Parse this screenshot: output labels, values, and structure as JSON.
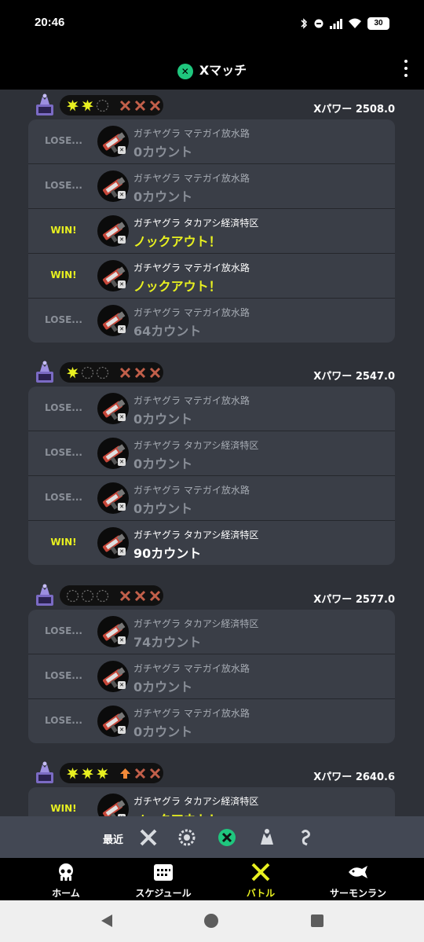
{
  "status": {
    "time": "20:46",
    "battery": "30"
  },
  "appbar": {
    "title": "Xマッチ"
  },
  "groups": [
    {
      "xpower": "Xパワー 2508.0",
      "rows": [
        {
          "result": "LOSE...",
          "type": "lose",
          "mode": "ガチヤグラ マテガイ放水路",
          "score": "0カウント",
          "score_style": "grey"
        },
        {
          "result": "LOSE...",
          "type": "lose",
          "mode": "ガチヤグラ マテガイ放水路",
          "score": "0カウント",
          "score_style": "grey"
        },
        {
          "result": "WIN!",
          "type": "win",
          "mode": "ガチヤグラ タカアシ経済特区",
          "score": "ノックアウト！",
          "score_style": "yellow"
        },
        {
          "result": "WIN!",
          "type": "win",
          "mode": "ガチヤグラ マテガイ放水路",
          "score": "ノックアウト！",
          "score_style": "yellow"
        },
        {
          "result": "LOSE...",
          "type": "lose",
          "mode": "ガチヤグラ マテガイ放水路",
          "score": "64カウント",
          "score_style": "grey"
        }
      ]
    },
    {
      "xpower": "Xパワー 2547.0",
      "rows": [
        {
          "result": "LOSE...",
          "type": "lose",
          "mode": "ガチヤグラ マテガイ放水路",
          "score": "0カウント",
          "score_style": "grey"
        },
        {
          "result": "LOSE...",
          "type": "lose",
          "mode": "ガチヤグラ タカアシ経済特区",
          "score": "0カウント",
          "score_style": "grey"
        },
        {
          "result": "LOSE...",
          "type": "lose",
          "mode": "ガチヤグラ マテガイ放水路",
          "score": "0カウント",
          "score_style": "grey"
        },
        {
          "result": "WIN!",
          "type": "win",
          "mode": "ガチヤグラ タカアシ経済特区",
          "score": "90カウント",
          "score_style": "white"
        }
      ]
    },
    {
      "xpower": "Xパワー 2577.0",
      "rows": [
        {
          "result": "LOSE...",
          "type": "lose",
          "mode": "ガチヤグラ タカアシ経済特区",
          "score": "74カウント",
          "score_style": "grey"
        },
        {
          "result": "LOSE...",
          "type": "lose",
          "mode": "ガチヤグラ マテガイ放水路",
          "score": "0カウント",
          "score_style": "grey"
        },
        {
          "result": "LOSE...",
          "type": "lose",
          "mode": "ガチヤグラ マテガイ放水路",
          "score": "0カウント",
          "score_style": "grey"
        }
      ]
    },
    {
      "xpower": "Xパワー 2640.6",
      "rows": [
        {
          "result": "WIN!",
          "type": "win",
          "mode": "ガチヤグラ タカアシ経済特区",
          "score": "ノックアウト！",
          "score_style": "yellow"
        }
      ]
    }
  ],
  "filter": {
    "label": "最近"
  },
  "nav": [
    {
      "label": "ホーム",
      "icon": "squid-icon"
    },
    {
      "label": "スケジュール",
      "icon": "calendar-icon"
    },
    {
      "label": "バトル",
      "icon": "battle-icon"
    },
    {
      "label": "サーモンラン",
      "icon": "salmon-icon"
    }
  ],
  "colors": {
    "win": "#e8f020",
    "lose": "#8a8f98",
    "accent": "#1fc77e",
    "nav_active": "#e8f020"
  }
}
